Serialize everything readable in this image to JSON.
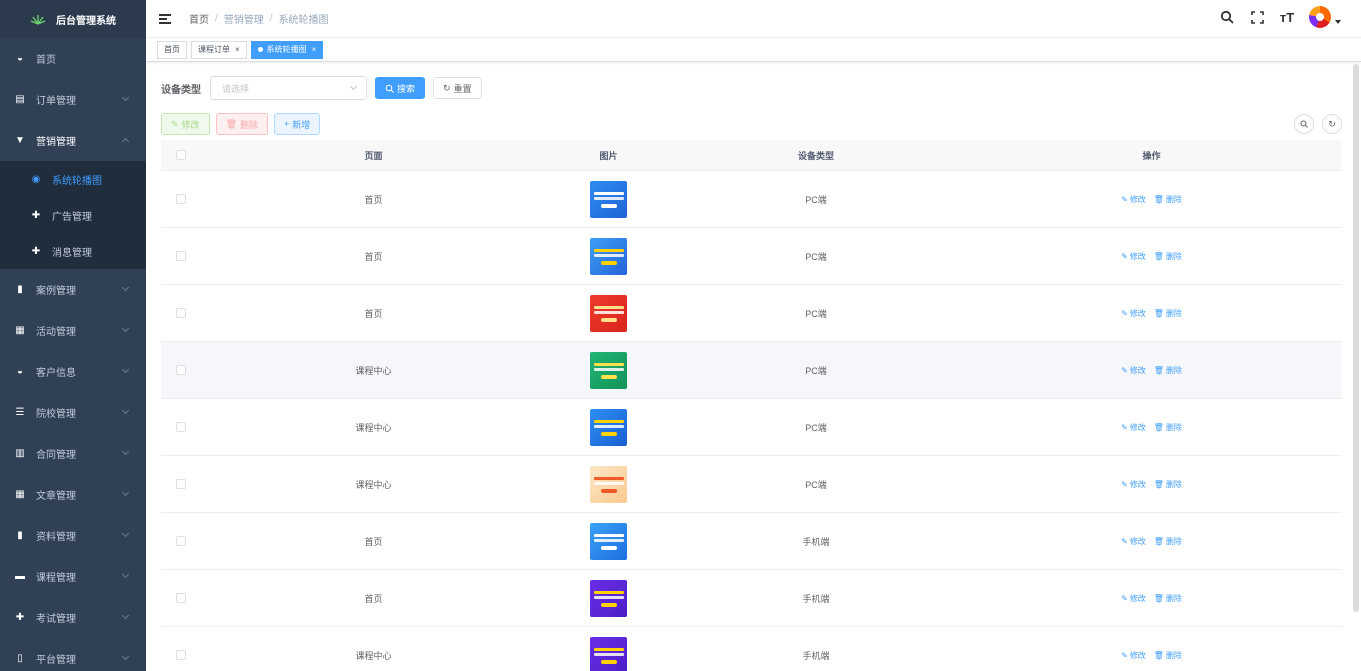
{
  "app": {
    "title": "后台管理系统"
  },
  "sidebar": {
    "items": [
      {
        "label": "首页",
        "icon": "dashboard-icon",
        "glyph": "◒"
      },
      {
        "label": "订单管理",
        "icon": "order-icon",
        "glyph": "▤",
        "arrow": true
      },
      {
        "label": "营销管理",
        "icon": "shirt-icon",
        "glyph": "▼",
        "arrow": true,
        "open": true,
        "children": [
          {
            "label": "系统轮播图",
            "icon": "eye-icon",
            "glyph": "◉",
            "active": true
          },
          {
            "label": "广告管理",
            "icon": "circle-plus-icon",
            "glyph": "✚"
          },
          {
            "label": "消息管理",
            "icon": "circle-plus-icon",
            "glyph": "✚"
          }
        ]
      },
      {
        "label": "案例管理",
        "icon": "book-icon",
        "glyph": "▮",
        "arrow": true
      },
      {
        "label": "活动管理",
        "icon": "document-icon",
        "glyph": "▦",
        "arrow": true
      },
      {
        "label": "客户信息",
        "icon": "dashboard-icon",
        "glyph": "◒",
        "arrow": true
      },
      {
        "label": "院校管理",
        "icon": "list-icon",
        "glyph": "☰",
        "arrow": true
      },
      {
        "label": "合同管理",
        "icon": "chart-icon",
        "glyph": "▥",
        "arrow": true
      },
      {
        "label": "文章管理",
        "icon": "document-icon",
        "glyph": "▦",
        "arrow": true
      },
      {
        "label": "资料管理",
        "icon": "folder-icon",
        "glyph": "▮",
        "arrow": true
      },
      {
        "label": "课程管理",
        "icon": "video-icon",
        "glyph": "▬",
        "arrow": true
      },
      {
        "label": "考试管理",
        "icon": "circle-plus-icon",
        "glyph": "✚",
        "arrow": true
      },
      {
        "label": "平台管理",
        "icon": "phone-icon",
        "glyph": "▯",
        "arrow": true
      }
    ]
  },
  "header": {
    "breadcrumb": [
      "首页",
      "营销管理",
      "系统轮播图"
    ],
    "icons": [
      "search-icon",
      "fullscreen-icon",
      "font-size-icon"
    ],
    "font_size_glyph": "ᴛT"
  },
  "tags": [
    {
      "label": "首页",
      "closable": false,
      "active": false
    },
    {
      "label": "课程订单",
      "closable": true,
      "active": false
    },
    {
      "label": "系统轮播图",
      "closable": true,
      "active": true
    }
  ],
  "search": {
    "label": "设备类型",
    "placeholder": "请选择",
    "search_btn": "搜索",
    "reset_btn": "重置"
  },
  "toolbar": {
    "edit": "修改",
    "delete": "删除",
    "add": "新增"
  },
  "table": {
    "headers": {
      "page": "页面",
      "image": "图片",
      "device": "设备类型",
      "ops": "操作"
    },
    "op_edit": "修改",
    "op_delete": "删除",
    "rows": [
      {
        "page": "首页",
        "device": "PC端",
        "img_colors": [
          "#2f8cf0",
          "#1e63d6"
        ],
        "accent": "#ffffff"
      },
      {
        "page": "首页",
        "device": "PC端",
        "img_colors": [
          "#3da0f5",
          "#2563d9"
        ],
        "accent": "#ffd200"
      },
      {
        "page": "首页",
        "device": "PC端",
        "img_colors": [
          "#ef3b2d",
          "#d9241a"
        ],
        "accent": "#ffe08a"
      },
      {
        "page": "课程中心",
        "device": "PC端",
        "img_colors": [
          "#21b573",
          "#13925a"
        ],
        "accent": "#ffe14d",
        "highlight": true
      },
      {
        "page": "课程中心",
        "device": "PC端",
        "img_colors": [
          "#2d8ff3",
          "#1a5fd0"
        ],
        "accent": "#ffd200"
      },
      {
        "page": "课程中心",
        "device": "PC端",
        "img_colors": [
          "#fde7c8",
          "#f9c98e"
        ],
        "accent": "#f05a28"
      },
      {
        "page": "首页",
        "device": "手机端",
        "img_colors": [
          "#3aa2f7",
          "#1e6fe0"
        ],
        "accent": "#ffffff"
      },
      {
        "page": "首页",
        "device": "手机端",
        "img_colors": [
          "#6a2ee8",
          "#4b1fc4"
        ],
        "accent": "#ffd200"
      },
      {
        "page": "课程中心",
        "device": "手机端",
        "img_colors": [
          "#6a2ee8",
          "#4b1fc4"
        ],
        "accent": "#ffd200"
      }
    ]
  },
  "colors": {
    "primary": "#409eff",
    "sidebar_bg": "#304156"
  }
}
